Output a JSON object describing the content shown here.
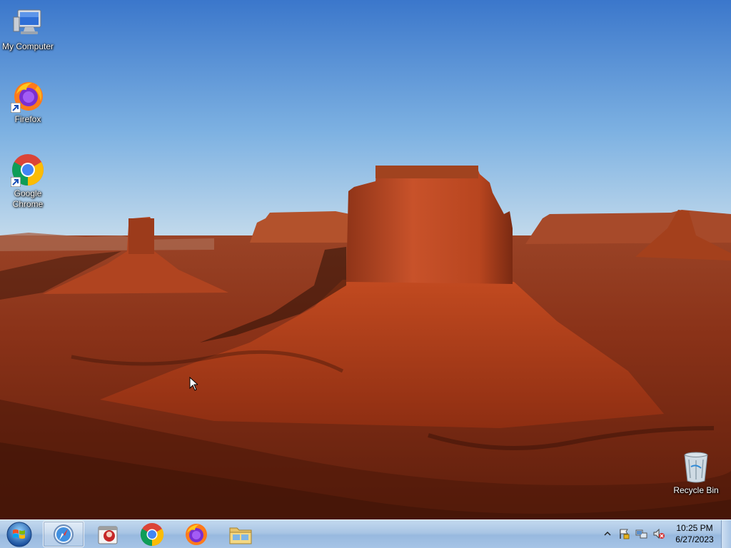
{
  "desktop": {
    "icons": [
      {
        "label": "My Computer",
        "icon": "my-computer-icon"
      },
      {
        "label": "Firefox",
        "icon": "firefox-icon"
      },
      {
        "label": "Google Chrome",
        "icon": "chrome-icon"
      },
      {
        "label": "Recycle Bin",
        "icon": "recycle-bin-icon"
      }
    ]
  },
  "taskbar": {
    "start_icon": "windows-start-orb-icon",
    "pinned": [
      {
        "icon": "safari-icon",
        "active": true
      },
      {
        "icon": "app-icon",
        "active": false
      },
      {
        "icon": "chrome-icon",
        "active": false
      },
      {
        "icon": "firefox-icon",
        "active": false
      },
      {
        "icon": "file-explorer-icon",
        "active": false
      }
    ],
    "tray": {
      "icons": [
        "show-hidden-icons-chevron-icon",
        "action-center-flag-icon",
        "network-icon",
        "volume-muted-icon"
      ],
      "time": "10:25 PM",
      "date": "6/27/2023"
    }
  },
  "colors": {
    "sky_top": "#3b78cc",
    "sky_bottom": "#9ccbe8",
    "rock": "#b5431c",
    "taskbar": "#a9c5e4"
  }
}
